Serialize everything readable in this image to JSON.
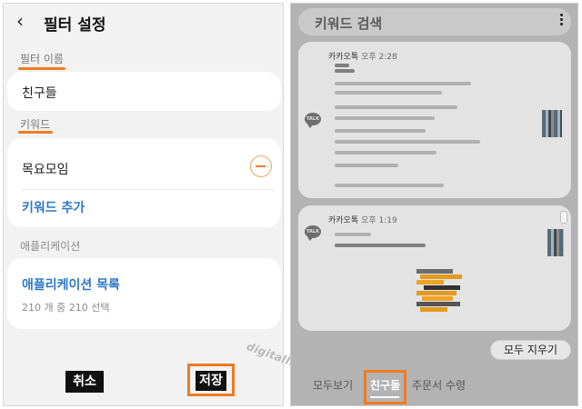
{
  "left": {
    "title": "필터 설정",
    "filter_name_label": "필터 이름",
    "filter_name_value": "친구들",
    "keyword_label": "키워드",
    "keyword_value": "목요모임",
    "add_keyword": "키워드 추가",
    "app_label": "애플리케이션",
    "app_list": "애플리케이션 목록",
    "app_count": "210 개 중 210 선택",
    "cancel": "취소",
    "save": "저장",
    "watermark": "digitalline"
  },
  "right": {
    "search_title": "키워드 검색",
    "notifications": [
      {
        "app": "카카오톡",
        "time": "오후 2:28",
        "icon": "TALK"
      },
      {
        "app": "카카오톡",
        "time": "오후 1:19",
        "icon": "TALK"
      }
    ],
    "clear_all": "모두 지우기",
    "tabs": [
      "모두보기",
      "친구들",
      "주문서 수령"
    ],
    "active_tab": "친구들"
  },
  "colors": {
    "highlight": "#ee7b22",
    "link": "#2d78c8",
    "button": "#111111"
  }
}
